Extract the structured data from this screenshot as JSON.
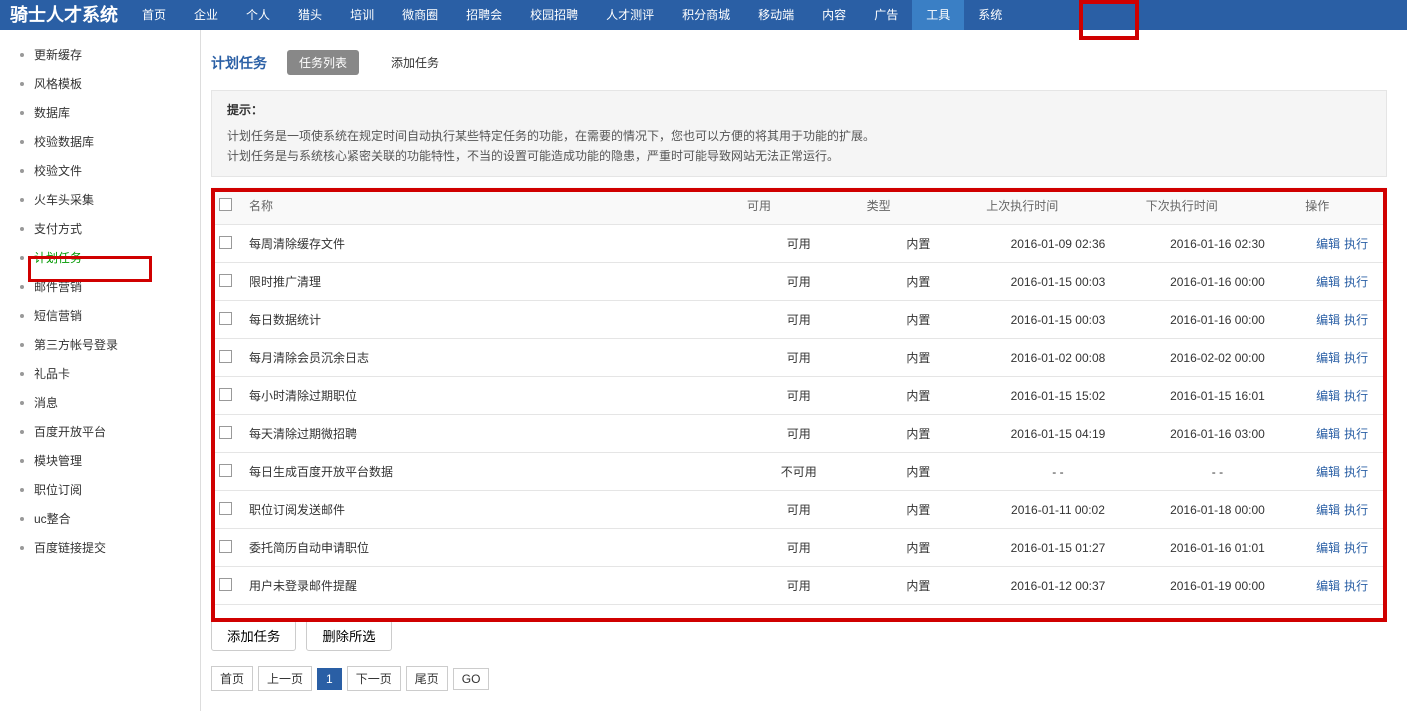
{
  "logo": "骑士人才系统",
  "top_nav": [
    "首页",
    "企业",
    "个人",
    "猎头",
    "培训",
    "微商圈",
    "招聘会",
    "校园招聘",
    "人才测评",
    "积分商城",
    "移动端",
    "内容",
    "广告",
    "工具",
    "系统"
  ],
  "top_nav_active_index": 13,
  "sidebar": [
    {
      "label": "更新缓存"
    },
    {
      "label": "风格模板"
    },
    {
      "label": "数据库"
    },
    {
      "label": "校验数据库"
    },
    {
      "label": "校验文件"
    },
    {
      "label": "火车头采集"
    },
    {
      "label": "支付方式"
    },
    {
      "label": "计划任务",
      "active": true
    },
    {
      "label": "邮件营销"
    },
    {
      "label": "短信营销"
    },
    {
      "label": "第三方帐号登录"
    },
    {
      "label": "礼品卡"
    },
    {
      "label": "消息"
    },
    {
      "label": "百度开放平台"
    },
    {
      "label": "模块管理"
    },
    {
      "label": "职位订阅"
    },
    {
      "label": "uc整合"
    },
    {
      "label": "百度链接提交"
    }
  ],
  "tabs": {
    "title": "计划任务",
    "list": "任务列表",
    "add": "添加任务"
  },
  "hint": {
    "title": "提示：",
    "line1": "计划任务是一项使系统在规定时间自动执行某些特定任务的功能，在需要的情况下，您也可以方便的将其用于功能的扩展。",
    "line2": "计划任务是与系统核心紧密关联的功能特性，不当的设置可能造成功能的隐患，严重时可能导致网站无法正常运行。"
  },
  "table": {
    "headers": {
      "name": "名称",
      "avail": "可用",
      "type": "类型",
      "last": "上次执行时间",
      "next": "下次执行时间",
      "action": "操作"
    },
    "rows": [
      {
        "name": "每周清除缓存文件",
        "avail": "可用",
        "type": "内置",
        "last": "2016-01-09 02:36",
        "next": "2016-01-16 02:30"
      },
      {
        "name": "限时推广清理",
        "avail": "可用",
        "type": "内置",
        "last": "2016-01-15 00:03",
        "next": "2016-01-16 00:00"
      },
      {
        "name": "每日数据统计",
        "avail": "可用",
        "type": "内置",
        "last": "2016-01-15 00:03",
        "next": "2016-01-16 00:00"
      },
      {
        "name": "每月清除会员沉余日志",
        "avail": "可用",
        "type": "内置",
        "last": "2016-01-02 00:08",
        "next": "2016-02-02 00:00"
      },
      {
        "name": "每小时清除过期职位",
        "avail": "可用",
        "type": "内置",
        "last": "2016-01-15 15:02",
        "next": "2016-01-15 16:01"
      },
      {
        "name": "每天清除过期微招聘",
        "avail": "可用",
        "type": "内置",
        "last": "2016-01-15 04:19",
        "next": "2016-01-16 03:00"
      },
      {
        "name": "每日生成百度开放平台数据",
        "avail": "不可用",
        "type": "内置",
        "last": "- -",
        "next": "- -"
      },
      {
        "name": "职位订阅发送邮件",
        "avail": "可用",
        "type": "内置",
        "last": "2016-01-11 00:02",
        "next": "2016-01-18 00:00"
      },
      {
        "name": "委托简历自动申请职位",
        "avail": "可用",
        "type": "内置",
        "last": "2016-01-15 01:27",
        "next": "2016-01-16 01:01"
      },
      {
        "name": "用户未登录邮件提醒",
        "avail": "可用",
        "type": "内置",
        "last": "2016-01-12 00:37",
        "next": "2016-01-19 00:00"
      }
    ],
    "action_edit": "编辑",
    "action_exec": "执行"
  },
  "buttons": {
    "add": "添加任务",
    "delete": "删除所选"
  },
  "pagination": {
    "first": "首页",
    "prev": "上一页",
    "current": "1",
    "next": "下一页",
    "last": "尾页",
    "go": "GO"
  }
}
